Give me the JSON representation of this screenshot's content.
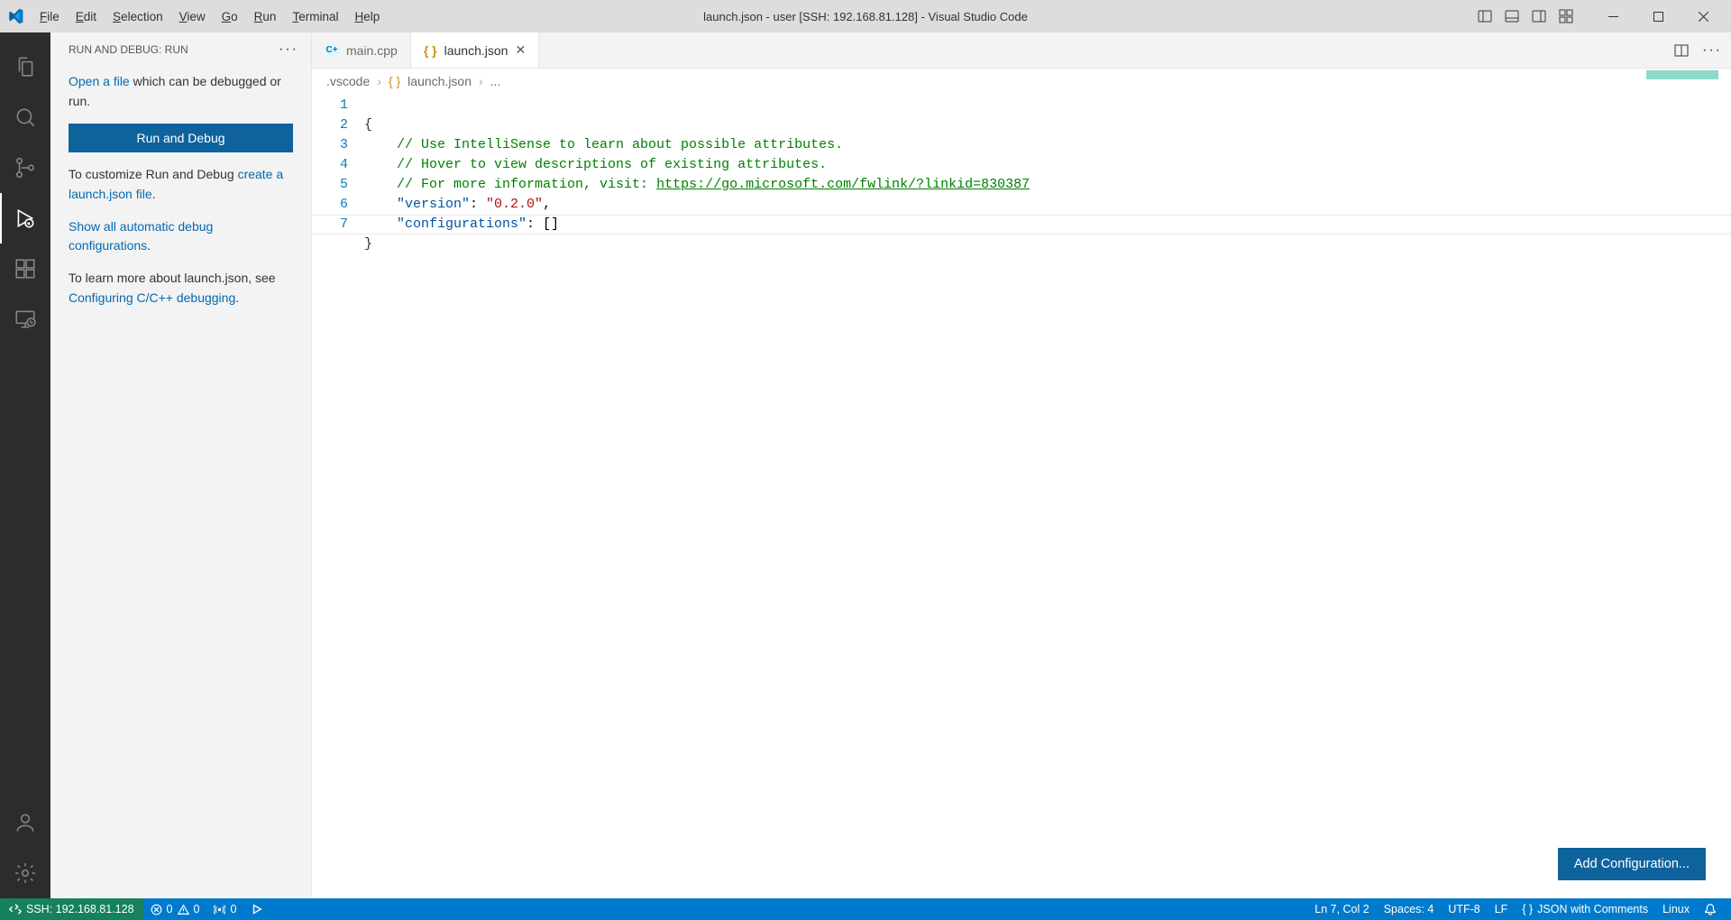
{
  "title": "launch.json - user [SSH: 192.168.81.128] - Visual Studio Code",
  "menu": {
    "file": "File",
    "edit": "Edit",
    "selection": "Selection",
    "view": "View",
    "go": "Go",
    "run": "Run",
    "terminal": "Terminal",
    "help": "Help"
  },
  "sidebar": {
    "header": "RUN AND DEBUG: RUN",
    "open_a_file": "Open a file",
    "open_rest": " which can be debugged or run.",
    "run_button": "Run and Debug",
    "customize_pre": "To customize Run and Debug ",
    "create_launch": "create a launch.json file",
    "show_auto_link": "Show all automatic debug configurations",
    "learn_pre": "To learn more about launch.json, see ",
    "cfg_link": "Configuring C/C++ debugging"
  },
  "tabs": {
    "main": "main.cpp",
    "launch": "launch.json"
  },
  "breadcrumb": {
    "root": ".vscode",
    "file": "launch.json",
    "dots": "..."
  },
  "code": {
    "l1": "{",
    "l2": "    // Use IntelliSense to learn about possible attributes.",
    "l3": "    // Hover to view descriptions of existing attributes.",
    "l4a": "    // For more information, visit: ",
    "l4url": "https://go.microsoft.com/fwlink/?linkid=830387",
    "l5k": "\"version\"",
    "l5v": "\"0.2.0\"",
    "l6k": "\"configurations\"",
    "l7": "}"
  },
  "lines": [
    "1",
    "2",
    "3",
    "4",
    "5",
    "6",
    "7"
  ],
  "add_cfg_btn": "Add Configuration...",
  "status": {
    "remote": "SSH: 192.168.81.128",
    "errors": "0",
    "warnings": "0",
    "ports": "0",
    "ln": "Ln 7, Col 2",
    "spaces": "Spaces: 4",
    "enc": "UTF-8",
    "eol": "LF",
    "lang": "JSON with Comments",
    "os": "Linux"
  }
}
